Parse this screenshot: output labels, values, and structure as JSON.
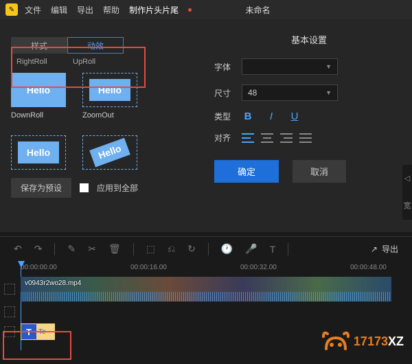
{
  "menubar": {
    "items": [
      "文件",
      "编辑",
      "导出",
      "帮助"
    ],
    "special": "制作片头片尾",
    "title": "未命名"
  },
  "left": {
    "tabs": {
      "style": "样式",
      "anim": "动效"
    },
    "labels": {
      "right": "RightRoll",
      "up": "UpRoll"
    },
    "items": [
      {
        "name": "DownRoll",
        "text": "Hello",
        "type": "arrows"
      },
      {
        "name": "ZoomOut",
        "text": "Hello",
        "type": "dash"
      },
      {
        "name": "",
        "text": "Hello",
        "type": "dash"
      },
      {
        "name": "",
        "text": "Hello",
        "type": "rotate"
      }
    ],
    "save_preset": "保存为预设",
    "apply_all": "应用到全部"
  },
  "settings": {
    "title": "基本设置",
    "font_label": "字体",
    "font_value": "",
    "size_label": "尺寸",
    "size_value": "48",
    "type_label": "类型",
    "bold": "B",
    "italic": "I",
    "underline": "U",
    "align_label": "对齐",
    "ok": "确定",
    "cancel": "取消"
  },
  "toolbar": {
    "export": "导出"
  },
  "timeline": {
    "marks": [
      "00:00:00.00",
      "00:00:16.00",
      "00:00:32.00",
      "00:00:48.00"
    ],
    "clip_name": "v0943r2wo28.mp4",
    "text_icon": "T",
    "text_suffix": "Te"
  },
  "edge": {
    "wide": "宽"
  },
  "watermark": {
    "a": "17173",
    "b": "XZ"
  }
}
